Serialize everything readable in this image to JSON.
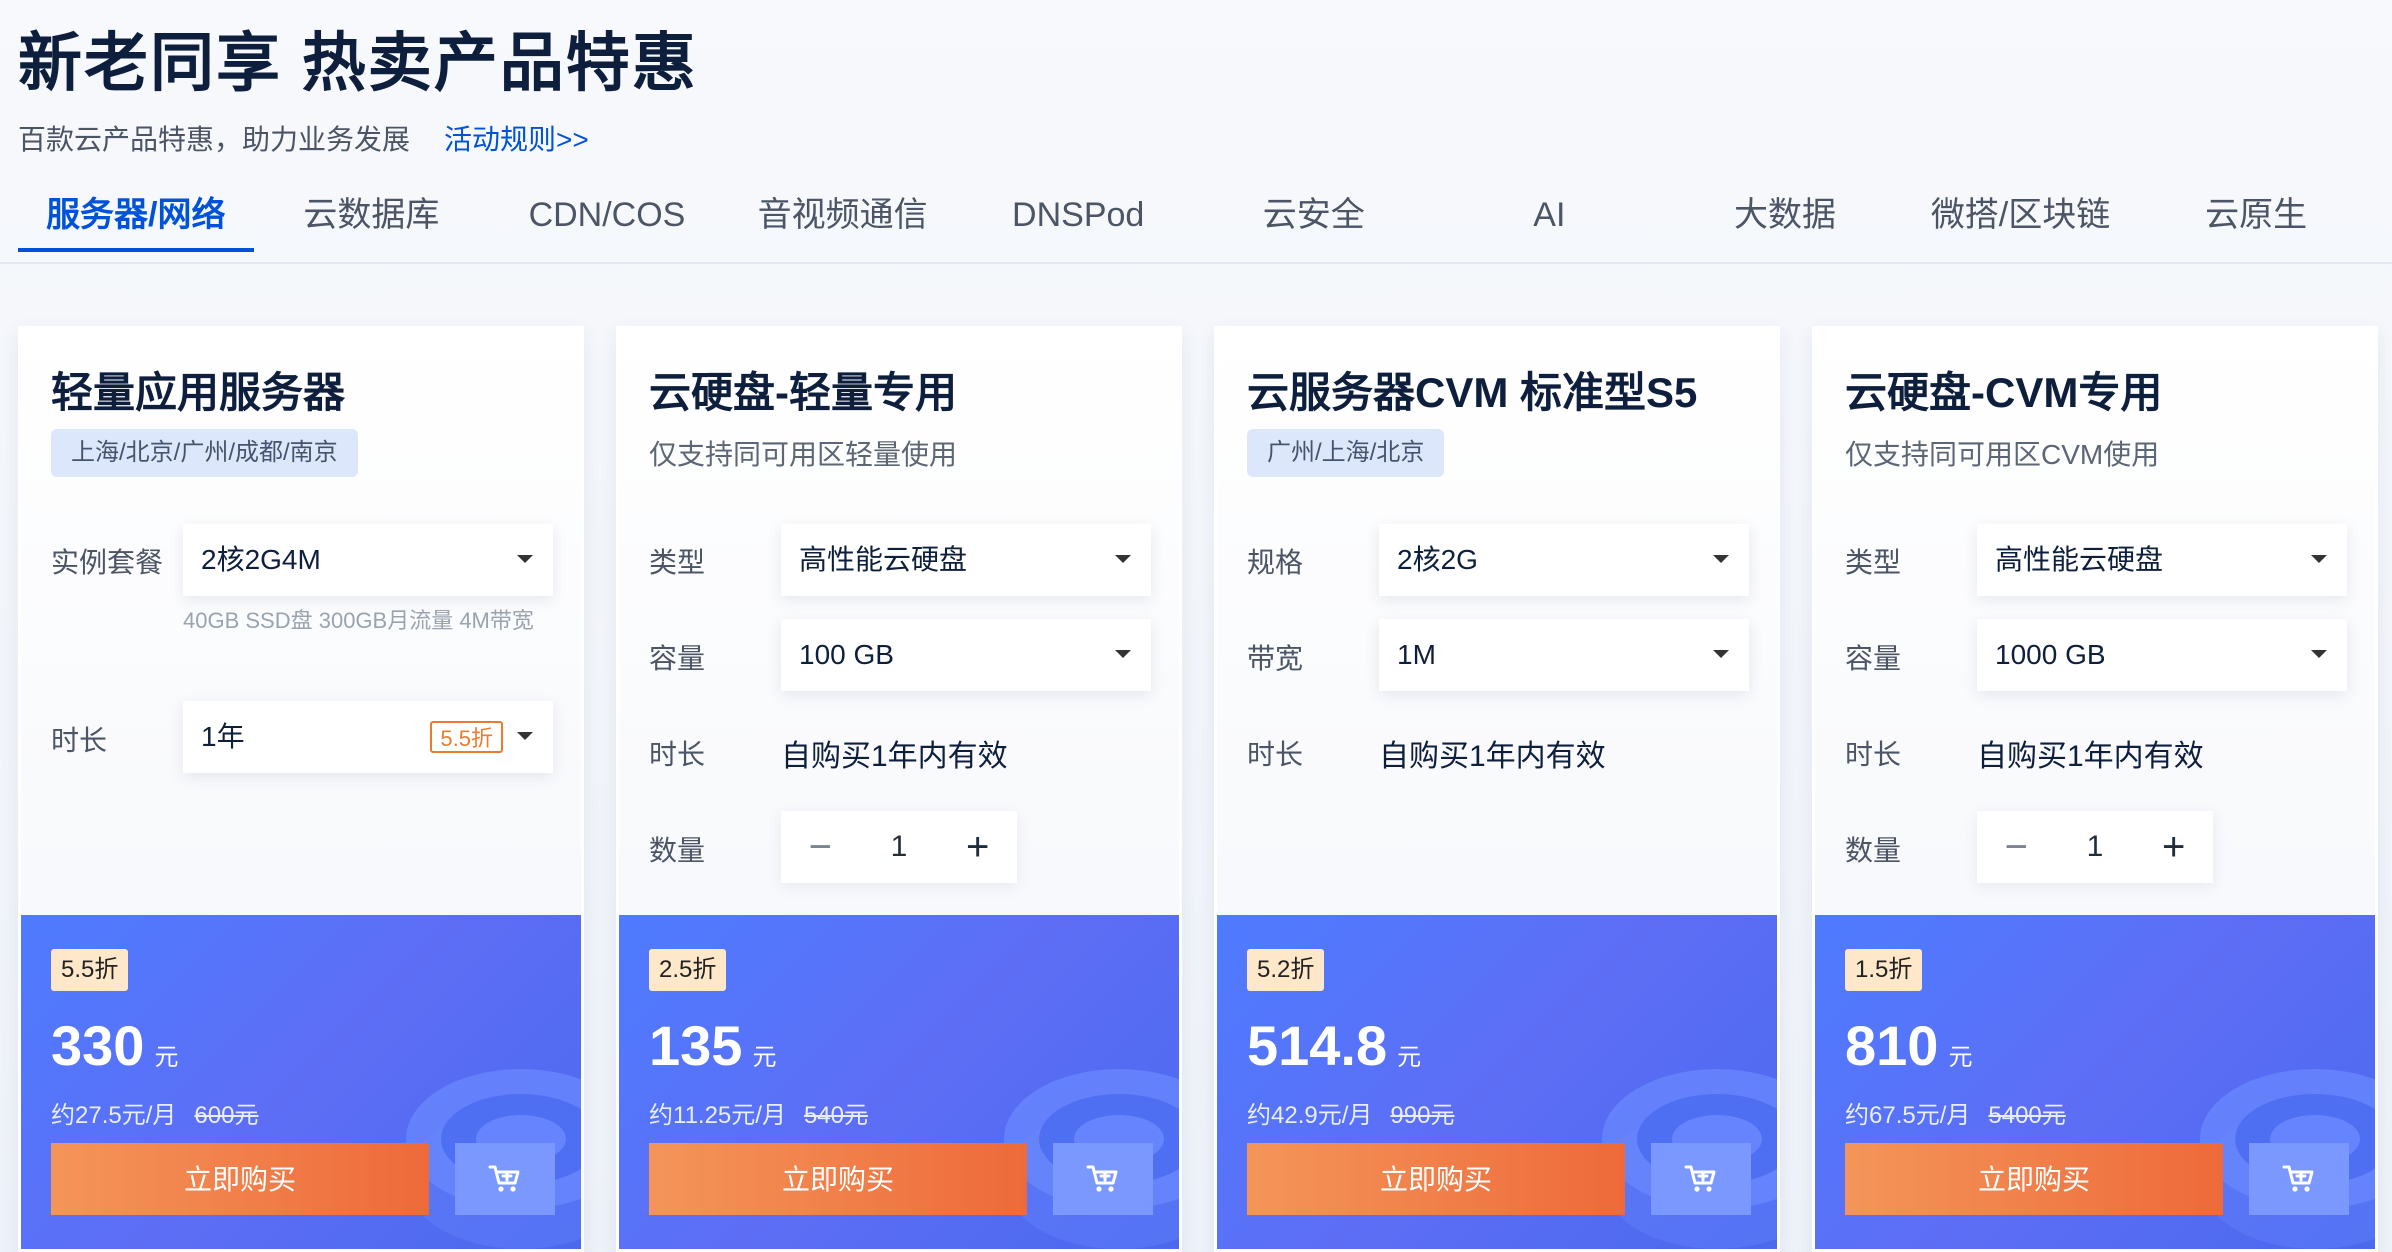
{
  "header": {
    "title": "新老同享 热卖产品特惠",
    "subtitle": "百款云产品特惠，助力业务发展",
    "rules_link": "活动规则>>"
  },
  "tabs": [
    {
      "label": "服务器/网络",
      "active": true
    },
    {
      "label": "云数据库"
    },
    {
      "label": "CDN/COS"
    },
    {
      "label": "音视频通信"
    },
    {
      "label": "DNSPod"
    },
    {
      "label": "云安全"
    },
    {
      "label": "AI"
    },
    {
      "label": "大数据"
    },
    {
      "label": "微搭/区块链"
    },
    {
      "label": "云原生"
    }
  ],
  "cards": [
    {
      "title": "轻量应用服务器",
      "region": "上海/北京/广州/成都/南京",
      "spec_label": "实例套餐",
      "spec_value": "2核2G4M",
      "spec_hint": "40GB SSD盘 300GB月流量 4M带宽",
      "duration_label": "时长",
      "duration_value": "1年",
      "duration_discount": "5.5折",
      "discount": "5.5折",
      "price": "330",
      "price_unit": "元",
      "monthly": "约27.5元/月",
      "original_price": "600元",
      "buy_label": "立即购买"
    },
    {
      "title": "云硬盘-轻量专用",
      "note": "仅支持同可用区轻量使用",
      "type_label": "类型",
      "type_value": "高性能云硬盘",
      "capacity_label": "容量",
      "capacity_value": "100 GB",
      "duration_label": "时长",
      "duration_value": "自购买1年内有效",
      "qty_label": "数量",
      "qty_value": "1",
      "qty_minus": "−",
      "qty_plus": "+",
      "discount": "2.5折",
      "price": "135",
      "price_unit": "元",
      "monthly": "约11.25元/月",
      "original_price": "540元",
      "buy_label": "立即购买"
    },
    {
      "title": "云服务器CVM 标准型S5",
      "region": "广州/上海/北京",
      "spec_label": "规格",
      "spec_value": "2核2G",
      "bandwidth_label": "带宽",
      "bandwidth_value": "1M",
      "duration_label": "时长",
      "duration_value": "自购买1年内有效",
      "discount": "5.2折",
      "price": "514.8",
      "price_unit": "元",
      "monthly": "约42.9元/月",
      "original_price": "990元",
      "buy_label": "立即购买"
    },
    {
      "title": "云硬盘-CVM专用",
      "note": "仅支持同可用区CVM使用",
      "type_label": "类型",
      "type_value": "高性能云硬盘",
      "capacity_label": "容量",
      "capacity_value": "1000 GB",
      "duration_label": "时长",
      "duration_value": "自购买1年内有效",
      "qty_label": "数量",
      "qty_value": "1",
      "qty_minus": "−",
      "qty_plus": "+",
      "discount": "1.5折",
      "price": "810",
      "price_unit": "元",
      "monthly": "约67.5元/月",
      "original_price": "5400元",
      "buy_label": "立即购买"
    }
  ],
  "icons": {
    "cart": "cart-icon",
    "dropdown": "chevron-down-icon",
    "decoration": "disk-decoration-icon"
  },
  "colors": {
    "accent": "#0052d9",
    "price_panel": "#5470f5",
    "buy_button": "#ee6a3a",
    "cart_button": "#7b98ff",
    "discount_badge": "#ffe8c9"
  }
}
